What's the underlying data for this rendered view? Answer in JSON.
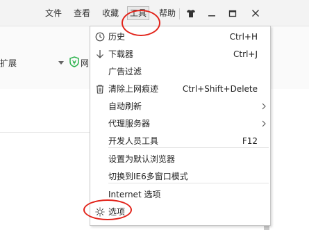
{
  "menubar": {
    "items": [
      {
        "label": "文件"
      },
      {
        "label": "查看"
      },
      {
        "label": "收藏"
      },
      {
        "label": "工具"
      },
      {
        "label": "帮助"
      }
    ],
    "window_buttons": [
      "shirt-icon",
      "minimize-icon",
      "restore-icon",
      "close-icon"
    ]
  },
  "toolbar": {
    "extensions_label": "扩展",
    "extension_text": "网"
  },
  "tools_menu": {
    "items": [
      {
        "label": "历史",
        "shortcut": "Ctrl+H",
        "icon": "clock-icon"
      },
      {
        "label": "下载器",
        "shortcut": "Ctrl+J",
        "icon": "download-arrow-icon"
      },
      {
        "label": "广告过滤",
        "shortcut": ""
      },
      {
        "label": "清除上网痕迹",
        "shortcut": "Ctrl+Shift+Delete",
        "icon": "trash-icon"
      },
      {
        "label": "自动刷新",
        "shortcut": "",
        "submenu": true
      },
      {
        "label": "代理服务器",
        "shortcut": "",
        "submenu": true
      },
      {
        "label": "开发人员工具",
        "shortcut": "F12"
      },
      {
        "label": "设置为默认浏览器",
        "shortcut": ""
      },
      {
        "label": "切换到IE6多窗口模式",
        "shortcut": ""
      },
      {
        "label": "Internet 选项",
        "shortcut": ""
      },
      {
        "label": "选项",
        "shortcut": "",
        "icon": "gear-icon"
      }
    ]
  },
  "colors": {
    "annotation": "#e2231a",
    "menubar_bg": "#f3f3f3",
    "shield": "#2bb24c"
  }
}
